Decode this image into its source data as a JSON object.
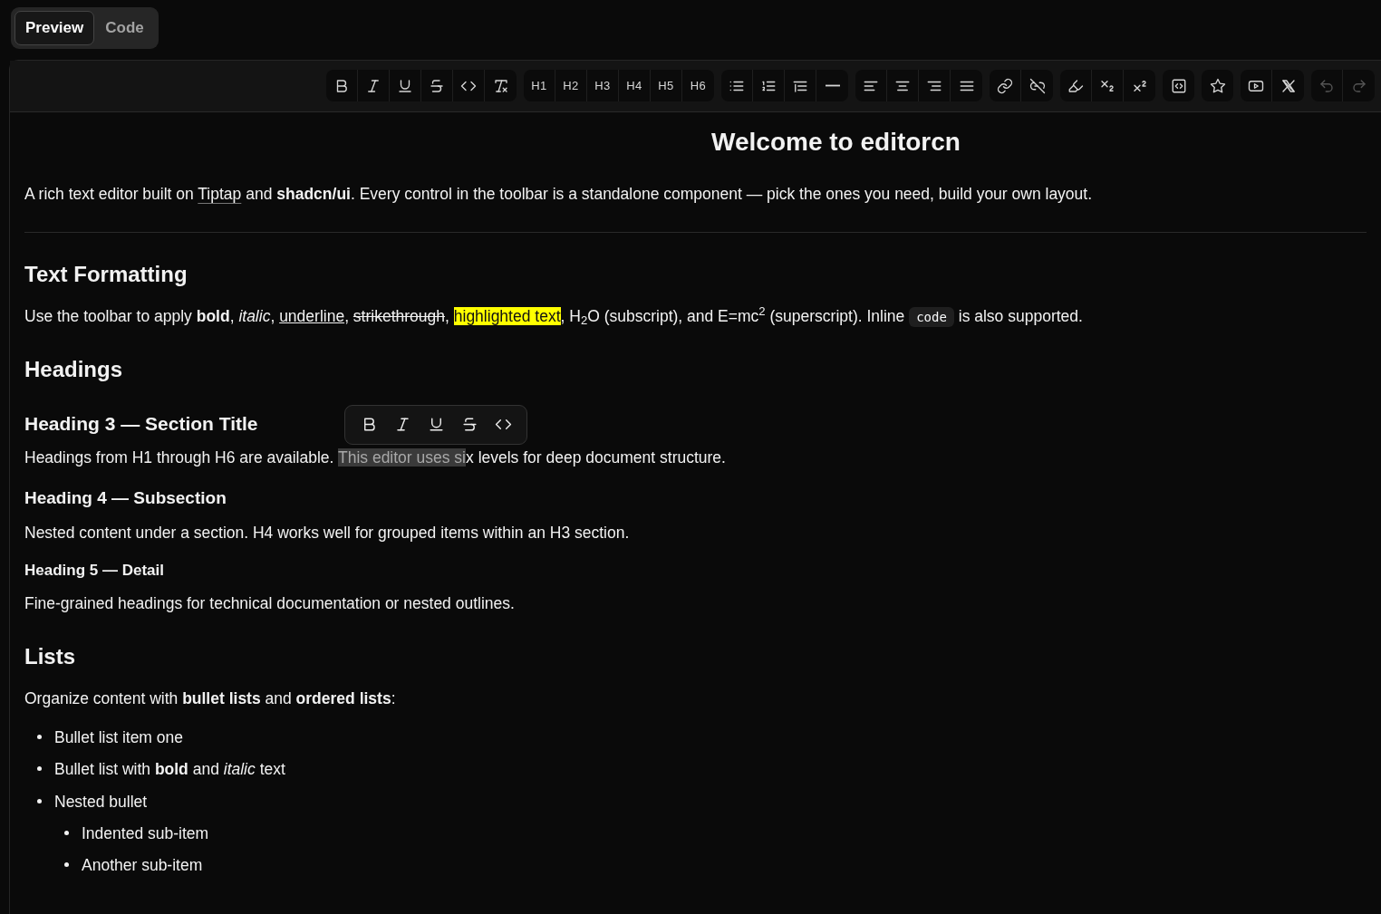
{
  "tabs": [
    {
      "label": "Preview",
      "selected": true
    },
    {
      "label": "Code",
      "selected": false
    }
  ],
  "toolbar": {
    "groups": [
      [
        {
          "disabled": false
        },
        {
          "disabled": false
        },
        {
          "disabled": false
        },
        {
          "disabled": false
        },
        {
          "disabled": false
        },
        {
          "disabled": false
        }
      ],
      [
        {
          "label": "H1",
          "disabled": false
        },
        {
          "label": "H2",
          "disabled": false
        },
        {
          "label": "H3",
          "disabled": false
        },
        {
          "label": "H4",
          "disabled": false
        },
        {
          "label": "H5",
          "disabled": false
        },
        {
          "label": "H6",
          "disabled": false
        }
      ],
      [
        {
          "disabled": false
        },
        {
          "disabled": false
        },
        {
          "disabled": false
        },
        {
          "disabled": false
        }
      ],
      [
        {
          "disabled": false
        },
        {
          "disabled": false
        },
        {
          "disabled": false
        },
        {
          "disabled": false
        }
      ],
      [
        {
          "disabled": false
        },
        {
          "disabled": false
        }
      ],
      [
        {
          "disabled": false
        },
        {
          "disabled": false
        },
        {
          "disabled": false
        }
      ],
      [
        {
          "disabled": false
        }
      ],
      [
        {
          "disabled": false
        }
      ],
      [
        {
          "disabled": false
        },
        {
          "disabled": false
        }
      ],
      [
        {
          "disabled": true
        },
        {
          "disabled": true
        }
      ]
    ]
  },
  "content": [
    {
      "kind": "title",
      "text": "Welcome to editorcn"
    },
    {
      "kind": "paragraph",
      "runs": [
        {
          "text": "A rich text editor built on "
        },
        {
          "text": "Tiptap",
          "link": true
        },
        {
          "text": " and "
        },
        {
          "text": "shadcn/ui",
          "bold": true
        },
        {
          "text": ". Every control in the toolbar is a standalone component — pick the ones you need, build your own layout."
        }
      ]
    },
    {
      "kind": "divider"
    },
    {
      "kind": "section",
      "text": "Text Formatting"
    },
    {
      "kind": "paragraph",
      "runs": [
        {
          "text": "Use the toolbar to apply "
        },
        {
          "text": "bold",
          "bold": true
        },
        {
          "text": ", "
        },
        {
          "text": "italic",
          "italic": true
        },
        {
          "text": ", "
        },
        {
          "text": "underline",
          "underline": true
        },
        {
          "text": ", "
        },
        {
          "text": "strikethrough",
          "strike": true
        },
        {
          "text": ", "
        },
        {
          "text": "highlighted text",
          "highlight": true
        },
        {
          "text": ", H"
        },
        {
          "text": "2",
          "sub": true
        },
        {
          "text": "O (subscript), and E=mc"
        },
        {
          "text": "2",
          "sup": true
        },
        {
          "text": " (superscript). Inline "
        },
        {
          "text": "code",
          "code": true
        },
        {
          "text": " is also supported."
        }
      ]
    },
    {
      "kind": "section",
      "text": "Headings"
    },
    {
      "kind": "subsection",
      "text": "Heading 3 — Section Title"
    },
    {
      "kind": "paragraph",
      "runs": [
        {
          "text": "Headings from H1 through H6 are available. "
        },
        {
          "text": "This editor uses si",
          "selected": true
        },
        {
          "text": "x levels for deep document structure."
        }
      ]
    },
    {
      "kind": "subsubsection",
      "text": "Heading 4 — Subsection"
    },
    {
      "kind": "paragraph",
      "runs": [
        {
          "text": "Nested content under a section. H4 works well for grouped items within an H3 section."
        }
      ]
    },
    {
      "kind": "minor",
      "text": "Heading 5 — Detail"
    },
    {
      "kind": "paragraph",
      "runs": [
        {
          "text": "Fine-grained headings for technical documentation or nested outlines."
        }
      ]
    },
    {
      "kind": "section",
      "text": "Lists"
    },
    {
      "kind": "paragraph",
      "runs": [
        {
          "text": "Organize content with "
        },
        {
          "text": "bullet lists",
          "bold": true
        },
        {
          "text": " and "
        },
        {
          "text": "ordered lists",
          "bold": true
        },
        {
          "text": ":"
        }
      ]
    },
    {
      "kind": "list",
      "items": [
        {
          "runs": [
            {
              "text": "Bullet list item one"
            }
          ]
        },
        {
          "runs": [
            {
              "text": "Bullet list with "
            },
            {
              "text": "bold",
              "bold": true
            },
            {
              "text": " and "
            },
            {
              "text": "italic",
              "italic": true
            },
            {
              "text": " text"
            }
          ]
        },
        {
          "runs": [
            {
              "text": "Nested bullet"
            }
          ],
          "children": [
            {
              "runs": [
                {
                  "text": "Indented sub-item"
                }
              ]
            },
            {
              "runs": [
                {
                  "text": "Another sub-item"
                }
              ]
            }
          ]
        }
      ]
    }
  ],
  "bubble_menu": [
    {
      "disabled": false
    },
    {
      "disabled": false
    },
    {
      "disabled": false
    },
    {
      "disabled": false
    },
    {
      "disabled": false
    }
  ]
}
